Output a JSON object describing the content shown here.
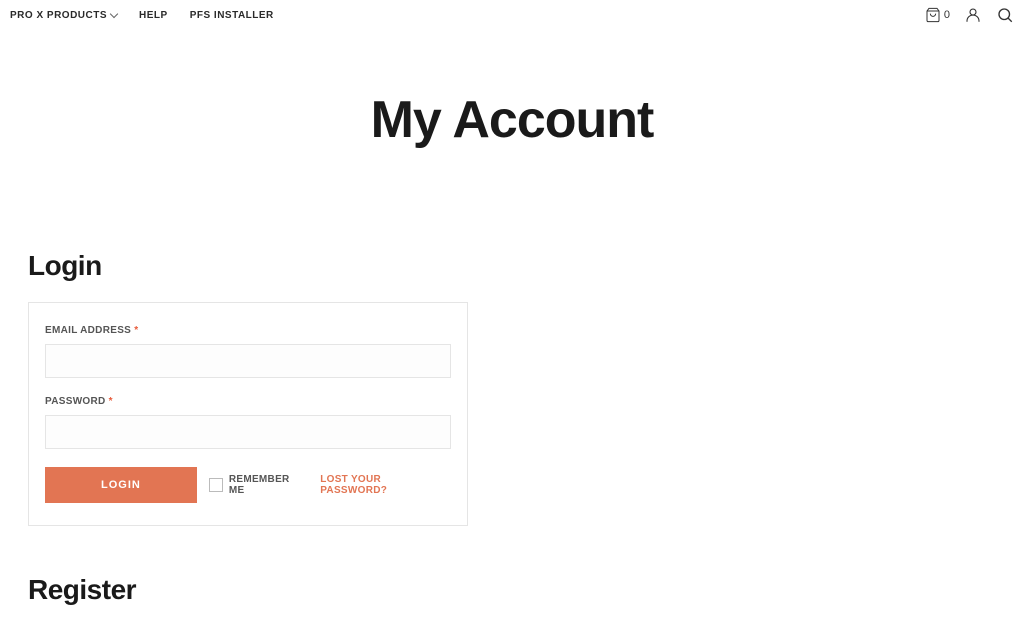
{
  "nav": {
    "items": [
      {
        "label": "PRO X PRODUCTS"
      },
      {
        "label": "HELP"
      },
      {
        "label": "PFS INSTALLER"
      }
    ],
    "cart_count": "0"
  },
  "page": {
    "title": "My Account"
  },
  "login": {
    "heading": "Login",
    "email_label": "EMAIL ADDRESS",
    "password_label": "PASSWORD",
    "required": "*",
    "button": "LOGIN",
    "remember": "REMEMBER ME",
    "lost_password": "LOST YOUR PASSWORD?",
    "email_value": "",
    "password_value": ""
  },
  "register": {
    "heading": "Register"
  }
}
